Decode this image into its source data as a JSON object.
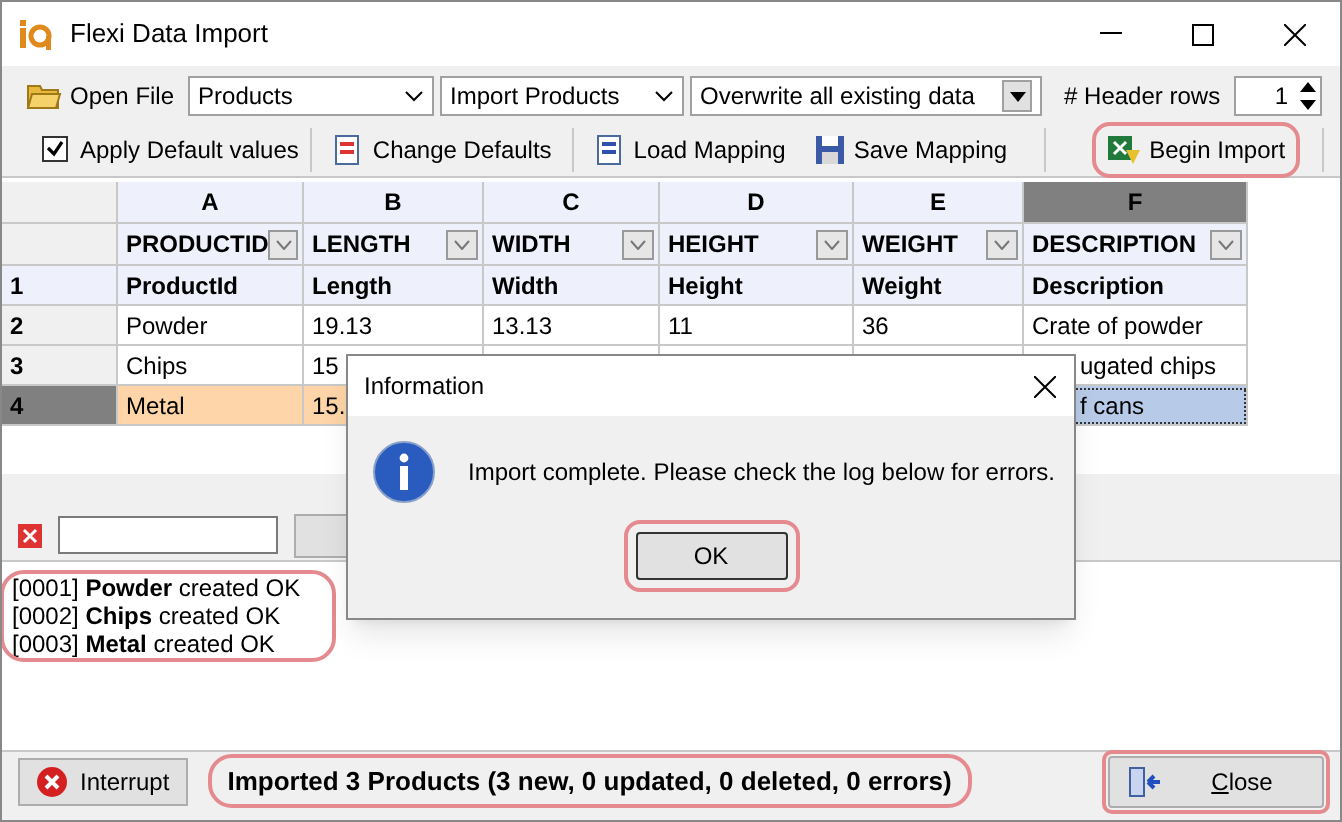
{
  "window": {
    "title": "Flexi Data Import"
  },
  "toolbar": {
    "open_file": "Open File",
    "table": "Products",
    "mapping": "Import Products",
    "mode": "Overwrite all existing data",
    "header_rows_label": "# Header rows",
    "header_rows": "1",
    "apply_defaults": {
      "label": "Apply Default values",
      "checked": true
    },
    "change_defaults": "Change Defaults",
    "load_mapping": "Load Mapping",
    "save_mapping": "Save Mapping",
    "begin_import": "Begin Import"
  },
  "grid": {
    "columns": [
      {
        "letter": "A",
        "field": "PRODUCTID",
        "selected": false
      },
      {
        "letter": "B",
        "field": "LENGTH",
        "selected": false
      },
      {
        "letter": "C",
        "field": "WIDTH",
        "selected": false
      },
      {
        "letter": "D",
        "field": "HEIGHT",
        "selected": false
      },
      {
        "letter": "E",
        "field": "WEIGHT",
        "selected": false
      },
      {
        "letter": "F",
        "field": "DESCRIPTION",
        "selected": true
      }
    ],
    "rows": [
      {
        "number": "1",
        "kind": "header",
        "selected": false,
        "cells": [
          "ProductId",
          "Length",
          "Width",
          "Height",
          "Weight",
          "Description"
        ]
      },
      {
        "number": "2",
        "kind": "data",
        "selected": false,
        "cells": [
          "Powder",
          "19.13",
          "13.13",
          "11",
          "36",
          "Crate of powder"
        ]
      },
      {
        "number": "3",
        "kind": "data",
        "selected": false,
        "cells": [
          "Chips",
          "15",
          null,
          null,
          null,
          "ugated chips"
        ]
      },
      {
        "number": "4",
        "kind": "data",
        "selected": true,
        "cells": [
          "Metal",
          "15.",
          null,
          null,
          null,
          "f cans"
        ]
      }
    ]
  },
  "dialog": {
    "title": "Information",
    "message": "Import complete. Please check the log below for errors.",
    "ok": "OK"
  },
  "log": [
    "[0001] **Powder** created OK",
    "[0002] **Chips** created OK",
    "[0003] **Metal** created OK"
  ],
  "status": {
    "interrupt": "Interrupt",
    "message": "Imported 3 Products (3 new, 0 updated, 0 deleted, 0 errors)",
    "close": "Close"
  }
}
